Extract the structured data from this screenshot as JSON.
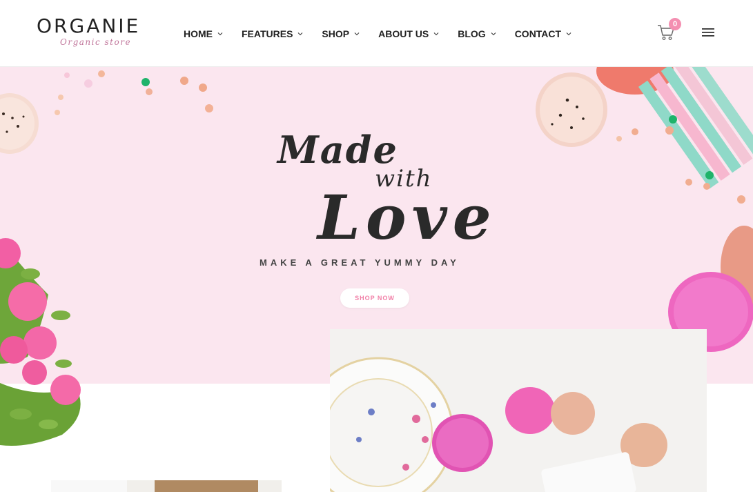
{
  "header": {
    "logo": {
      "name": "ORGANIE",
      "tagline": "Organic store"
    },
    "nav": [
      {
        "label": "HOME"
      },
      {
        "label": "FEATURES"
      },
      {
        "label": "SHOP"
      },
      {
        "label": "ABOUT US"
      },
      {
        "label": "BLOG"
      },
      {
        "label": "CONTACT"
      }
    ],
    "cart_count": "0",
    "icons": {
      "cart": "cart-icon",
      "menu": "hamburger-menu-icon",
      "chevron": "chevron-down-icon"
    }
  },
  "hero": {
    "line1": "Made",
    "line2": "with",
    "line3": "Love",
    "tagline": "MAKE A GREAT YUMMY DAY",
    "button_label": "SHOP NOW"
  },
  "colors": {
    "accent": "#f48fb1",
    "hero_bg": "#fbe6ef",
    "text": "#222222"
  }
}
